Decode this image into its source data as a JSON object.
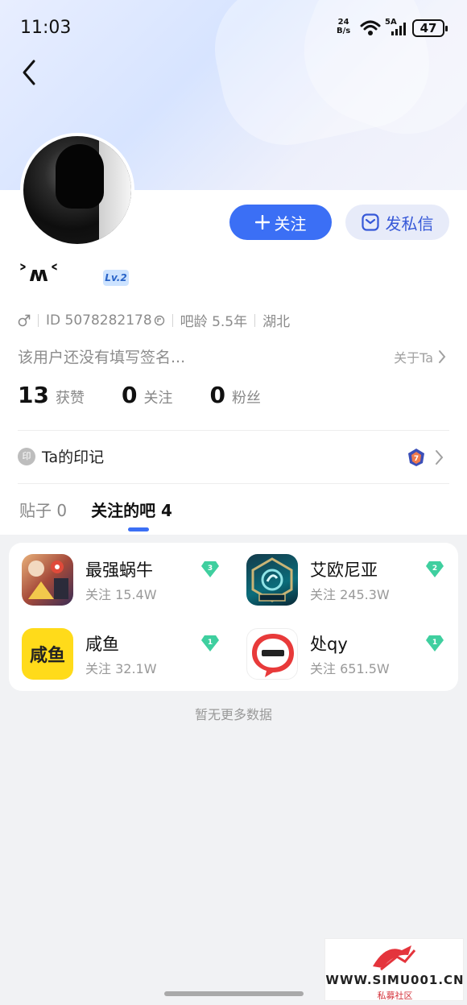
{
  "status_bar": {
    "time": "11:03",
    "net_speed_value": "24",
    "net_speed_unit": "B/s",
    "signal_label": "5A",
    "battery": "47"
  },
  "profile": {
    "username": "˃ʍ˂",
    "level": "Lv.2",
    "gender_icon": "male-icon",
    "id_text": "ID 5078282178",
    "bar_age": "吧龄 5.5年",
    "location": "湖北",
    "signature": "该用户还没有填写签名...",
    "about_label": "关于Ta"
  },
  "actions": {
    "follow_label": "关注",
    "message_label": "发私信"
  },
  "stats": [
    {
      "value": "13",
      "label": "获赞"
    },
    {
      "value": "0",
      "label": "关注"
    },
    {
      "value": "0",
      "label": "粉丝"
    }
  ],
  "seal": {
    "icon_text": "印",
    "title": "Ta的印记"
  },
  "tabs": [
    {
      "label": "贴子 0"
    },
    {
      "label": "关注的吧 4"
    }
  ],
  "forums": [
    {
      "name": "最强蜗牛",
      "followers": "关注 15.4W",
      "level": "3"
    },
    {
      "name": "艾欧尼亚",
      "followers": "关注 245.3W",
      "level": "2"
    },
    {
      "name": "咸鱼",
      "followers": "关注 32.1W",
      "level": "1"
    },
    {
      "name": "处qy",
      "followers": "关注 651.5W",
      "level": "1"
    }
  ],
  "forum_icon_text": {
    "xianyu": "咸鱼"
  },
  "footer": {
    "no_more": "暂无更多数据"
  },
  "watermark": {
    "site": "WWW.SIMU001.CN",
    "subtitle": "私募社区"
  },
  "colors": {
    "accent": "#3b6ff5",
    "message_bg": "#e7ebf9",
    "gem": "#3fcf9f",
    "page_bg": "#f1f2f4"
  }
}
